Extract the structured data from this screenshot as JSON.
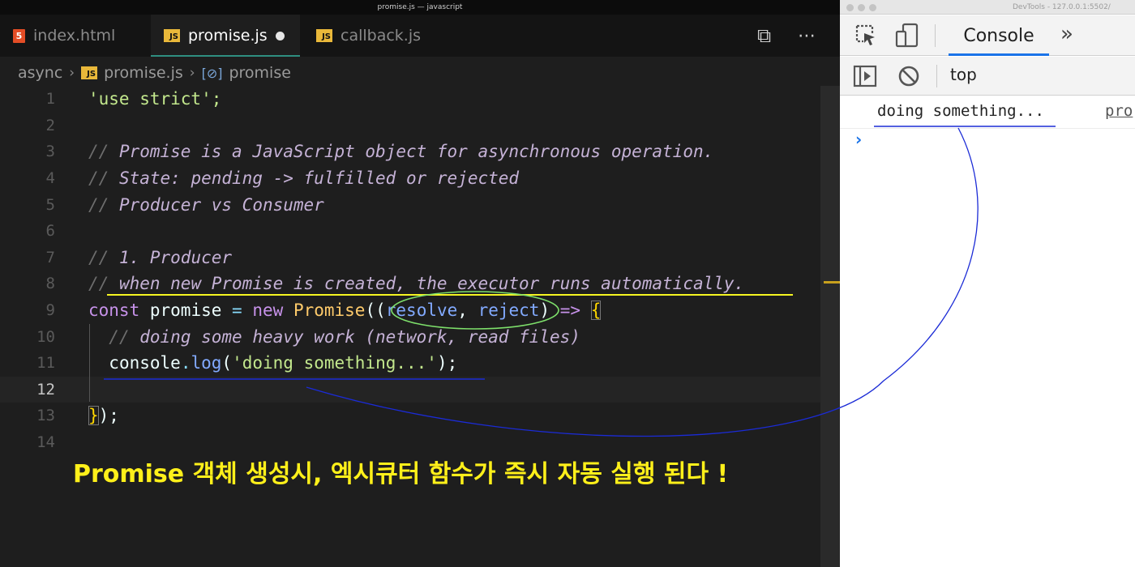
{
  "window_title": "promise.js — javascript",
  "tabs": [
    {
      "label": "index.html",
      "icon": "html-file-icon"
    },
    {
      "label": "promise.js",
      "icon": "js-file-icon",
      "modified": true
    },
    {
      "label": "callback.js",
      "icon": "js-file-icon"
    }
  ],
  "file_icon_text": {
    "html": "5",
    "js": "JS"
  },
  "editor_actions": {
    "split_icon": "⧉",
    "more_icon": "⋯"
  },
  "breadcrumb": {
    "folder": "async",
    "file": "promise.js",
    "symbol_icon": "[⊘]",
    "symbol": "promise"
  },
  "code_lines": [
    {
      "n": "1"
    },
    {
      "n": "2"
    },
    {
      "n": "3"
    },
    {
      "n": "4"
    },
    {
      "n": "5"
    },
    {
      "n": "6"
    },
    {
      "n": "7"
    },
    {
      "n": "8"
    },
    {
      "n": "9"
    },
    {
      "n": "10"
    },
    {
      "n": "11"
    },
    {
      "n": "12"
    },
    {
      "n": "13"
    },
    {
      "n": "14"
    }
  ],
  "code": {
    "l1": "'use strict';",
    "l3": "Promise is a JavaScript object for asynchronous operation.",
    "l4": "State: pending -> fulfilled or rejected",
    "l5": "Producer vs Consumer",
    "l7": "1. Producer",
    "l8": "when new Promise is created, the executor runs automatically.",
    "l9": {
      "const": "const",
      "name": "promise",
      "eq": "=",
      "new": "new",
      "cls": "Promise",
      "open": "((",
      "p1": "resolve",
      "comma": ",",
      "p2": "reject",
      "close": ")",
      "arrow": "=>",
      "brace": "{"
    },
    "l10": "doing some heavy work (network, read files)",
    "l11": {
      "obj": "console",
      "dot": ".",
      "fn": "log",
      "open": "(",
      "str": "'doing something...'",
      "close": ");"
    },
    "l13": {
      "brace": "}",
      "rest": ");"
    },
    "comment_slash": "//"
  },
  "caption": "Promise 객체 생성시, 엑시큐터 함수가 즉시 자동 실행 된다 !",
  "devtools": {
    "title": "DevTools - 127.0.0.1:5502/",
    "inspect_icon": "inspect-icon",
    "device_icon": "device-toggle-icon",
    "tab_console": "Console",
    "more_tabs": "»",
    "sidebar_icon": "sidebar-toggle-icon",
    "clear_icon": "clear-console-icon",
    "context": "top",
    "message": "doing something...",
    "source": "pro",
    "prompt": "›"
  },
  "colors": {
    "caption": "#fff01a",
    "annotation_blue": "#1b2bd6",
    "annotation_yellow": "#f5f521",
    "annotation_green": "#7ee06b"
  }
}
